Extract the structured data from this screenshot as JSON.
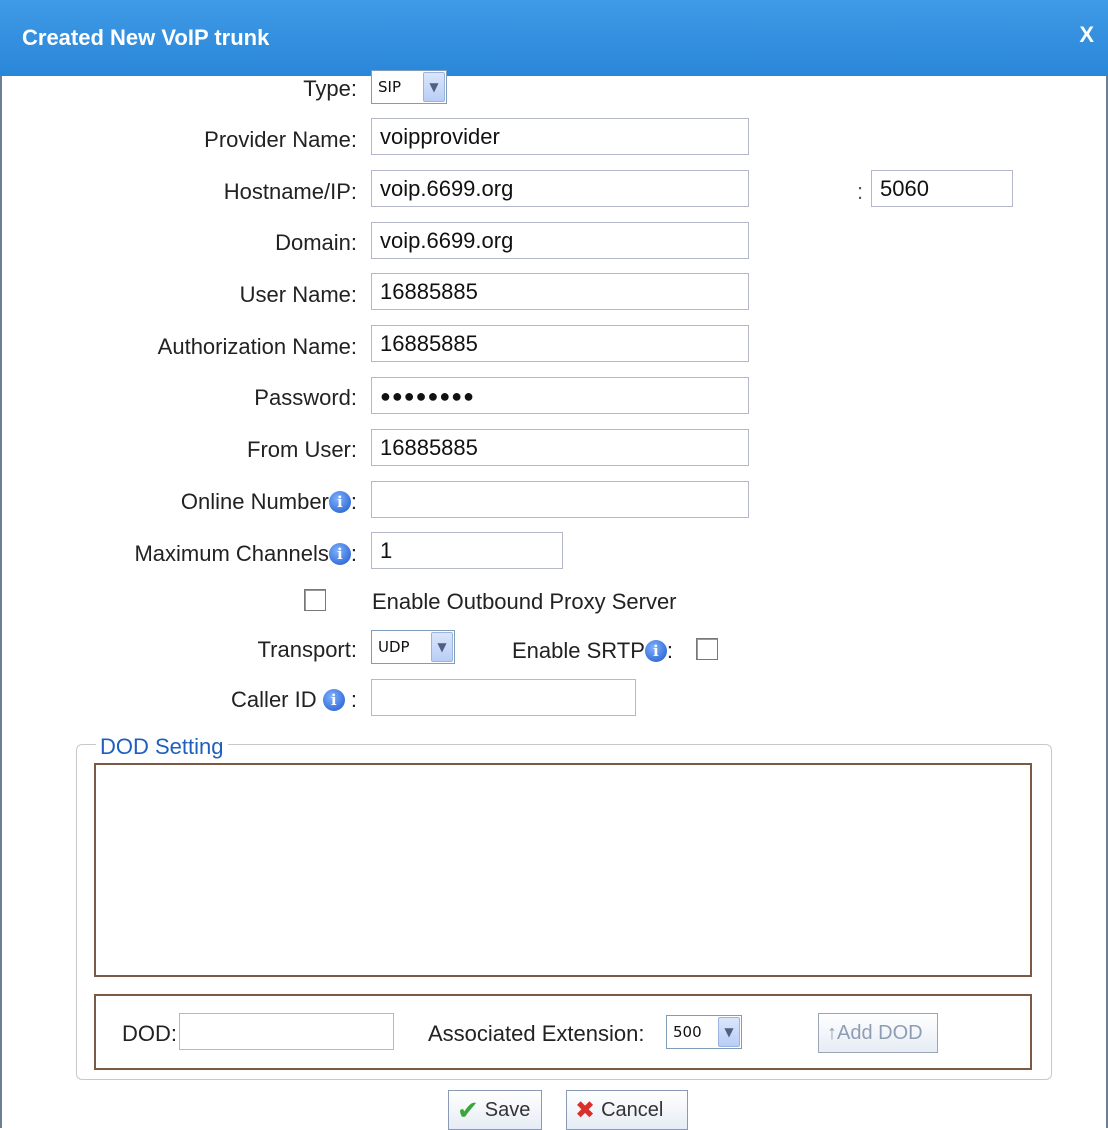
{
  "dialog": {
    "title": "Created New VoIP trunk",
    "close_label": "X"
  },
  "form": {
    "type_label": "Type:",
    "type_value": "SIP",
    "provider_name_label": "Provider Name:",
    "provider_name_value": "voipprovider",
    "hostname_label": "Hostname/IP:",
    "hostname_value": "voip.6699.org",
    "port_separator": ":",
    "port_value": "5060",
    "domain_label": "Domain:",
    "domain_value": "voip.6699.org",
    "user_name_label": "User Name:",
    "user_name_value": "16885885",
    "auth_name_label": "Authorization Name:",
    "auth_name_value": "16885885",
    "password_label": "Password:",
    "password_value": "●●●●●●●●",
    "from_user_label": "From User:",
    "from_user_value": "16885885",
    "online_number_label": "Online Number",
    "online_number_value": "",
    "max_channels_label": "Maximum Channels",
    "max_channels_value": "1",
    "outbound_proxy_label": "Enable Outbound Proxy Server",
    "transport_label": "Transport:",
    "transport_value": "UDP",
    "srtp_label": "Enable SRTP",
    "caller_id_label": "Caller ID",
    "caller_id_value": "",
    "colon": ":"
  },
  "dod": {
    "legend": "DOD Setting",
    "dod_label": "DOD:",
    "dod_value": "",
    "assoc_ext_label": "Associated Extension:",
    "assoc_ext_value": "500",
    "add_button": "↑Add DOD"
  },
  "footer": {
    "save_label": "Save",
    "cancel_label": "Cancel"
  }
}
